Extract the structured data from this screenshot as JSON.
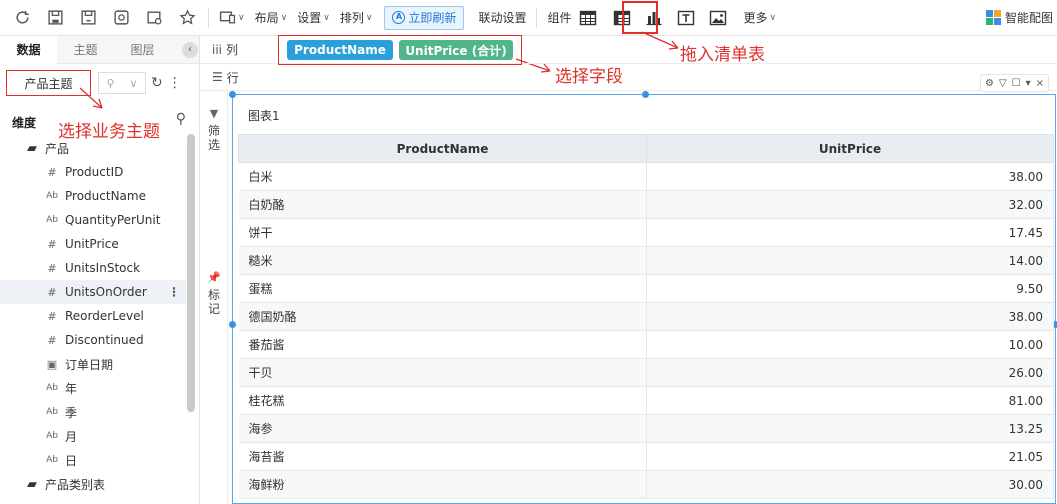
{
  "toolbar": {
    "layout_label": "布局",
    "settings_label": "设置",
    "arrange_label": "排列",
    "refresh_label": "立即刷新",
    "linkage_label": "联动设置",
    "component_label": "组件",
    "more_label": "更多",
    "smart_label": "智能配图",
    "accent": "#1f7ad6"
  },
  "left_panel": {
    "tabs": [
      "数据",
      "主题",
      "图层"
    ],
    "topic": "产品主题",
    "dimension_header": "维度",
    "tree": [
      {
        "type": "folder",
        "label": "产品",
        "icon": "folder-icon"
      },
      {
        "type": "field",
        "label": "ProductID",
        "icon": "hash-icon"
      },
      {
        "type": "field",
        "label": "ProductName",
        "icon": "text-icon"
      },
      {
        "type": "field",
        "label": "QuantityPerUnit",
        "icon": "text-icon"
      },
      {
        "type": "field",
        "label": "UnitPrice",
        "icon": "hash-icon"
      },
      {
        "type": "field",
        "label": "UnitsInStock",
        "icon": "hash-icon"
      },
      {
        "type": "field",
        "label": "UnitsOnOrder",
        "icon": "hash-icon",
        "selected": true
      },
      {
        "type": "field",
        "label": "ReorderLevel",
        "icon": "hash-icon"
      },
      {
        "type": "field",
        "label": "Discontinued",
        "icon": "hash-icon"
      },
      {
        "type": "field",
        "label": "订单日期",
        "icon": "calendar-icon"
      },
      {
        "type": "field",
        "label": "年",
        "icon": "text-icon"
      },
      {
        "type": "field",
        "label": "季",
        "icon": "text-icon"
      },
      {
        "type": "field",
        "label": "月",
        "icon": "text-icon"
      },
      {
        "type": "field",
        "label": "日",
        "icon": "text-icon"
      },
      {
        "type": "folder",
        "label": "产品类别表",
        "icon": "folder-icon"
      }
    ]
  },
  "annotations": {
    "select_topic": "选择业务主题",
    "select_fields": "选择字段",
    "drag_table": "拖入清单表",
    "color": "#e0302b"
  },
  "shelf": {
    "columns_label": "列",
    "rows_label": "行",
    "column_pills": [
      "ProductName",
      "UnitPrice (合计)"
    ]
  },
  "side_strip": {
    "filter_label": "筛选",
    "mark_label": "标记"
  },
  "chart": {
    "title": "图表1",
    "headers": [
      "ProductName",
      "UnitPrice"
    ],
    "rows": [
      [
        "白米",
        "38.00"
      ],
      [
        "白奶酪",
        "32.00"
      ],
      [
        "饼干",
        "17.45"
      ],
      [
        "糙米",
        "14.00"
      ],
      [
        "蛋糕",
        "9.50"
      ],
      [
        "德国奶酪",
        "38.00"
      ],
      [
        "番茄酱",
        "10.00"
      ],
      [
        "干贝",
        "26.00"
      ],
      [
        "桂花糕",
        "81.00"
      ],
      [
        "海参",
        "13.25"
      ],
      [
        "海苔酱",
        "21.05"
      ],
      [
        "海鲜粉",
        "30.00"
      ]
    ]
  }
}
